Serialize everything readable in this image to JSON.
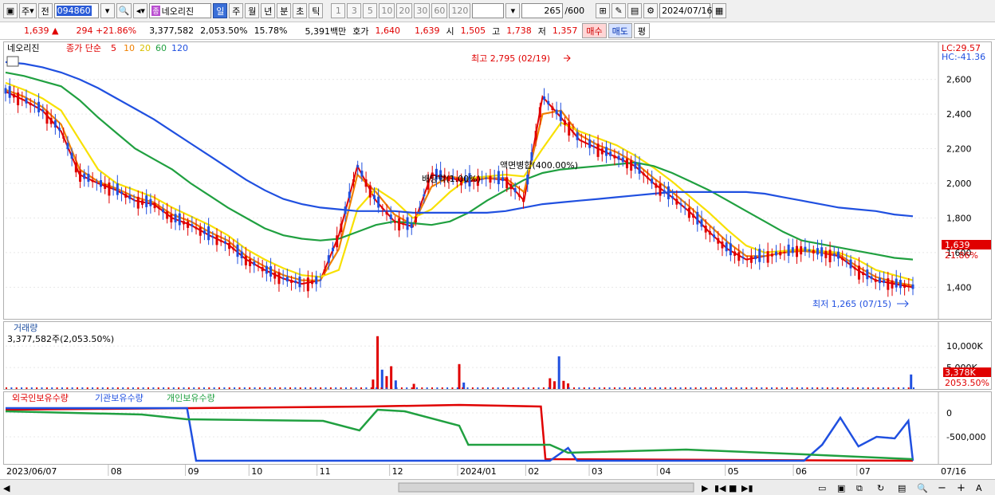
{
  "toolbar": {
    "period_label": "주",
    "prev_label": "전",
    "code": "094860",
    "stock_tag": "종",
    "stock_name": "네오리진",
    "intervals": [
      "일",
      "주",
      "월",
      "년",
      "분",
      "초",
      "틱"
    ],
    "active_interval": "일",
    "nums": [
      "1",
      "3",
      "5",
      "10",
      "20",
      "30",
      "60",
      "120"
    ],
    "count": "265",
    "count_max": "/600",
    "date": "2024/07/16"
  },
  "quote": {
    "price": "1,639",
    "change": "294",
    "change_pct": "+21.86%",
    "volume": "3,377,582",
    "vol_pct": "2,053.50%",
    "turnover_pct": "15.78%",
    "amount": "5,391백만",
    "hoga_label": "호가",
    "hoga_ask": "1,640",
    "hoga_bid": "1,639",
    "open_label": "시",
    "open": "1,505",
    "high_label": "고",
    "high": "1,738",
    "low_label": "저",
    "low": "1,357",
    "buy": "매수",
    "sell": "매도",
    "avg": "평"
  },
  "price_panel": {
    "stock_label": "네오리진",
    "ma_label": "종가 단순",
    "ma_periods": [
      "5",
      "10",
      "20",
      "60",
      "120"
    ],
    "ma_colors": [
      "#e00000",
      "#f08000",
      "#f8e000",
      "#20a040",
      "#2050e0"
    ],
    "lc": "LC:29.57",
    "hc": "HC:-41.36",
    "y_ticks": [
      "2,600",
      "2,400",
      "2,200",
      "2,000",
      "1,800",
      "1,600",
      "1,400"
    ],
    "high_note": "최고 2,795 (02/19)",
    "low_note": "최저 1,265 (07/15)",
    "dividend_note": "배당락(1.00%)",
    "merge_note": "액면병합(400.00%)",
    "last_price": "1,639",
    "last_pct": "21.86%"
  },
  "volume_panel": {
    "title": "거래량",
    "value": "3,377,582주(2,053.50%)",
    "y_ticks": [
      "10,000K",
      "5,000K"
    ],
    "last_value": "3,378K",
    "last_pct": "2053.50%"
  },
  "holdings_panel": {
    "foreign": "외국인보유수량",
    "inst": "기관보유수량",
    "indiv": "개인보유수량",
    "y_ticks": [
      "0",
      "-500,000"
    ],
    "colors": {
      "foreign": "#e00000",
      "inst": "#2050e0",
      "indiv": "#20a040"
    }
  },
  "x_axis": [
    "2023/06/07",
    "08",
    "09",
    "10",
    "11",
    "12",
    "2024/01",
    "02",
    "03",
    "04",
    "05",
    "06",
    "07",
    "07/16"
  ],
  "chart_data": {
    "type": "line",
    "title": "",
    "ylim": [
      1265,
      2795
    ],
    "y_axis_label": "",
    "series": [
      {
        "name": "5",
        "values": [
          2530,
          2480,
          2420,
          2300,
          2050,
          2000,
          1960,
          1900,
          1880,
          1800,
          1760,
          1700,
          1650,
          1560,
          1500,
          1450,
          1420,
          1440,
          1700,
          2100,
          1900,
          1780,
          1750,
          2050,
          2030,
          2010,
          2030,
          2020,
          1900,
          2500,
          2380,
          2250,
          2200,
          2150,
          2100,
          2000,
          1920,
          1830,
          1720,
          1620,
          1560,
          1580,
          1600,
          1620,
          1600,
          1580,
          1500,
          1440,
          1420,
          1400
        ]
      },
      {
        "name": "10",
        "values": [
          2540,
          2500,
          2440,
          2340,
          2080,
          2010,
          1970,
          1920,
          1890,
          1820,
          1780,
          1720,
          1670,
          1580,
          1520,
          1470,
          1440,
          1440,
          1620,
          2050,
          1950,
          1820,
          1760,
          1980,
          2040,
          2020,
          2030,
          2030,
          1950,
          2400,
          2420,
          2280,
          2220,
          2180,
          2120,
          2030,
          1950,
          1860,
          1760,
          1660,
          1580,
          1580,
          1600,
          1610,
          1600,
          1590,
          1520,
          1460,
          1430,
          1410
        ]
      },
      {
        "name": "20",
        "values": [
          2580,
          2540,
          2490,
          2420,
          2250,
          2080,
          2000,
          1960,
          1920,
          1860,
          1810,
          1760,
          1700,
          1620,
          1560,
          1510,
          1470,
          1460,
          1500,
          1850,
          1970,
          1900,
          1800,
          1850,
          1950,
          2030,
          2040,
          2050,
          2040,
          2200,
          2350,
          2300,
          2260,
          2220,
          2160,
          2090,
          2010,
          1920,
          1830,
          1730,
          1640,
          1600,
          1610,
          1620,
          1610,
          1600,
          1560,
          1500,
          1470,
          1440
        ]
      },
      {
        "name": "60",
        "values": [
          2640,
          2620,
          2590,
          2560,
          2480,
          2380,
          2290,
          2200,
          2140,
          2080,
          2000,
          1930,
          1860,
          1800,
          1740,
          1700,
          1680,
          1670,
          1680,
          1720,
          1760,
          1780,
          1770,
          1760,
          1780,
          1830,
          1900,
          1960,
          2020,
          2060,
          2080,
          2090,
          2100,
          2110,
          2120,
          2100,
          2060,
          2010,
          1960,
          1900,
          1840,
          1780,
          1720,
          1670,
          1650,
          1630,
          1610,
          1590,
          1570,
          1560
        ]
      },
      {
        "name": "120",
        "values": [
          2700,
          2690,
          2670,
          2640,
          2600,
          2550,
          2490,
          2430,
          2370,
          2300,
          2230,
          2160,
          2090,
          2020,
          1960,
          1910,
          1880,
          1860,
          1850,
          1840,
          1840,
          1840,
          1830,
          1830,
          1830,
          1830,
          1830,
          1840,
          1860,
          1880,
          1890,
          1900,
          1910,
          1920,
          1930,
          1940,
          1950,
          1950,
          1950,
          1950,
          1950,
          1940,
          1920,
          1900,
          1880,
          1860,
          1850,
          1840,
          1820,
          1810
        ]
      }
    ],
    "volume_bars": [
      {
        "idx": 0.405,
        "v": 2200
      },
      {
        "idx": 0.41,
        "v": 12300
      },
      {
        "idx": 0.415,
        "v": 4500
      },
      {
        "idx": 0.42,
        "v": 3000
      },
      {
        "idx": 0.425,
        "v": 5300
      },
      {
        "idx": 0.43,
        "v": 2000
      },
      {
        "idx": 0.45,
        "v": 1200
      },
      {
        "idx": 0.5,
        "v": 5800
      },
      {
        "idx": 0.505,
        "v": 1500
      },
      {
        "idx": 0.6,
        "v": 2500
      },
      {
        "idx": 0.605,
        "v": 1800
      },
      {
        "idx": 0.61,
        "v": 7600
      },
      {
        "idx": 0.615,
        "v": 1900
      },
      {
        "idx": 0.62,
        "v": 1300
      },
      {
        "idx": 0.998,
        "v": 3378
      }
    ]
  }
}
